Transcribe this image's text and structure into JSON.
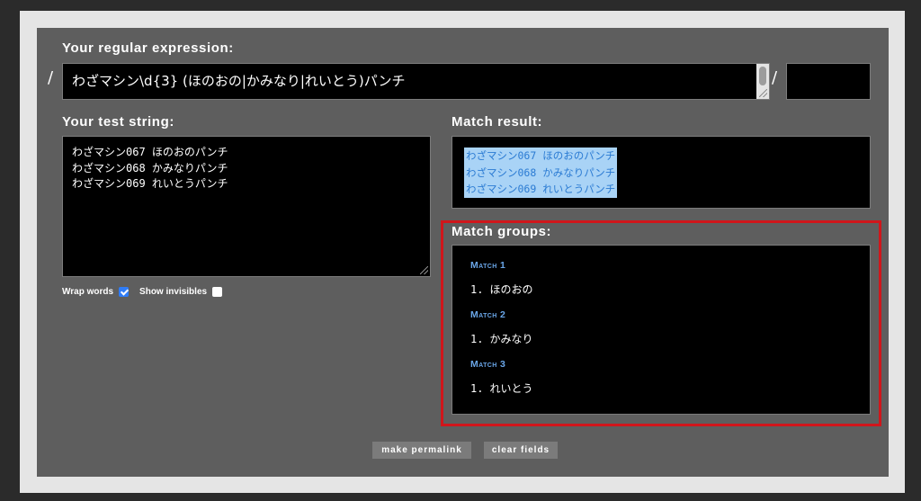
{
  "colors": {
    "page_background": "#2b2b2b",
    "frame": "#e5e5e5",
    "panel": "#5e5e5e",
    "field_background": "#000000",
    "label_text": "#ffffff",
    "match_header": "#6aa6e8",
    "match_highlight_background": "#a9d3f6",
    "match_highlight_text": "#2b7bd3",
    "annotation_outline": "#d0161b",
    "button_background": "#7b7b7b",
    "checkbox_checked": "#2f7cf6"
  },
  "regex": {
    "label": "Your regular expression:",
    "open_delimiter": "/",
    "pattern": "わざマシン\\d{3} (ほのおの|かみなり|れいとう)パンチ",
    "close_delimiter": "/"
  },
  "test_string": {
    "label": "Your test string:",
    "value": "わざマシン067 ほのおのパンチ\nわざマシン068 かみなりパンチ\nわざマシン069 れいとうパンチ"
  },
  "toggles": {
    "wrap_words": {
      "label": "Wrap words",
      "checked": true
    },
    "show_invisibles": {
      "label": "Show invisibles",
      "checked": false
    }
  },
  "match_result": {
    "label": "Match result:",
    "lines": [
      "わざマシン067 ほのおのパンチ",
      "わざマシン068 かみなりパンチ",
      "わざマシン069 れいとうパンチ"
    ]
  },
  "match_groups": {
    "label": "Match groups:",
    "matches": [
      {
        "title": "Match 1",
        "groups": [
          {
            "number": "1.",
            "value": "ほのおの"
          }
        ]
      },
      {
        "title": "Match 2",
        "groups": [
          {
            "number": "1.",
            "value": "かみなり"
          }
        ]
      },
      {
        "title": "Match 3",
        "groups": [
          {
            "number": "1.",
            "value": "れいとう"
          }
        ]
      }
    ]
  },
  "buttons": {
    "make_permalink": "make permalink",
    "clear_fields": "clear fields"
  }
}
